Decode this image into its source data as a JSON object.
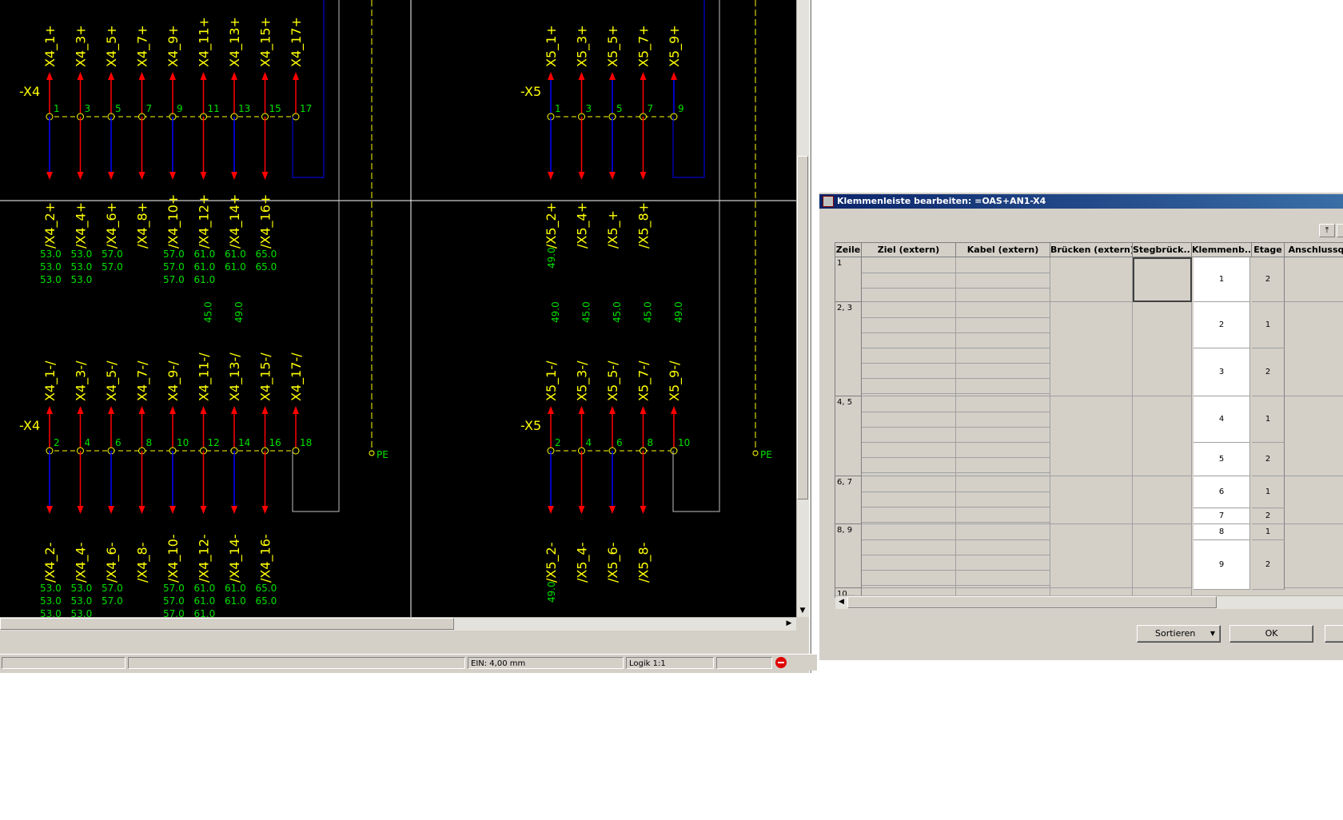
{
  "cad": {
    "colors": {
      "background": "#000000",
      "wire_red": "#ff0000",
      "wire_blue": "#0000ff",
      "wire_gray": "#c0c0c0",
      "text_yellow": "#ffff00",
      "text_green": "#00e000"
    },
    "blocks": {
      "x4_top": {
        "strip": "-X4",
        "terminals": [
          "1",
          "3",
          "5",
          "7",
          "9",
          "11",
          "13",
          "15",
          "17"
        ],
        "top_labels": [
          "X4_1+",
          "X4_3+",
          "X4_5+",
          "X4_7+",
          "X4_9+",
          "X4_11+",
          "X4_13+",
          "X4_15+",
          "X4_17+"
        ],
        "bottom_labels": [
          "/X4_2+",
          "/X4_4+",
          "/X4_6+",
          "/X4_8+",
          "/X4_10+",
          "/X4_12+",
          "/X4_14+",
          "/X4_16+"
        ],
        "xrefs": [
          [
            "53.0",
            "53.0",
            "53.0"
          ],
          [
            "53.0",
            "53.0",
            "53.0"
          ],
          [
            "57.0",
            "57.0"
          ],
          [],
          [
            "57.0",
            "57.0",
            "57.0"
          ],
          [
            "61.0",
            "61.0",
            "61.0"
          ],
          [
            "61.0",
            "61.0"
          ],
          [
            "65.0",
            "65.0"
          ]
        ]
      },
      "x5_top": {
        "strip": "-X5",
        "terminals": [
          "1",
          "3",
          "5",
          "7",
          "9"
        ],
        "top_labels": [
          "X5_1+",
          "X5_3+",
          "X5_5+",
          "X5_7+",
          "X5_9+"
        ],
        "bottom_labels": [
          "/X5_2+",
          "/X5_4+",
          "/X5_+",
          "/X5_8+"
        ],
        "side_xref": "49.0"
      },
      "x4_bottom": {
        "strip": "-X4",
        "terminals": [
          "2",
          "4",
          "6",
          "8",
          "10",
          "12",
          "14",
          "16",
          "18"
        ],
        "top_labels": [
          "X4_1-/",
          "X4_3-/",
          "X4_5-/",
          "X4_7-/",
          "X4_9-/",
          "X4_11-/",
          "X4_13-/",
          "X4_15-/",
          "X4_17-/"
        ],
        "top_xrefs": [
          "",
          "",
          "",
          "",
          "",
          "45.0",
          "49.0",
          "",
          ""
        ],
        "bottom_labels": [
          "/X4_2-",
          "/X4_4-",
          "/X4_6-",
          "/X4_8-",
          "/X4_10-",
          "/X4_12-",
          "/X4_14-",
          "/X4_16-"
        ],
        "xrefs": [
          [
            "53.0",
            "53.0",
            "53.0"
          ],
          [
            "53.0",
            "53.0",
            "53.0"
          ],
          [
            "57.0",
            "57.0"
          ],
          [],
          [
            "57.0",
            "57.0",
            "57.0"
          ],
          [
            "61.0",
            "61.0",
            "61.0"
          ],
          [
            "61.0",
            "61.0"
          ],
          [
            "65.0",
            "65.0"
          ]
        ]
      },
      "x5_bottom": {
        "strip": "-X5",
        "terminals": [
          "2",
          "4",
          "6",
          "8",
          "10"
        ],
        "top_labels": [
          "X5_1-/",
          "X5_3-/",
          "X5_5-/",
          "X5_7-/",
          "X5_9-/"
        ],
        "top_xrefs": [
          "49.0",
          "45.0",
          "45.0",
          "45.0",
          "49.0"
        ],
        "bottom_labels": [
          "/X5_2-",
          "/X5_4-",
          "/X5_6-",
          "/X5_8-"
        ],
        "side_xref": "49.0"
      }
    },
    "pe_label": "PE"
  },
  "statusbar": {
    "cell1": "",
    "cell2": "",
    "ein": "EIN: 4,00 mm",
    "logik": "Logik 1:1",
    "cell5": ""
  },
  "dialog": {
    "title": "Klemmenleiste bearbeiten: =OAS+AN1-X4",
    "toolbar_icon": "sort-up-icon",
    "columns": [
      "Zeile",
      "Ziel (extern)",
      "Kabel (extern)",
      "Brücken (extern)",
      "Stegbrück...",
      "Klemmenb...",
      "Etage",
      "Anschlussq"
    ],
    "rows": [
      {
        "zeile": "1"
      },
      {
        "zeile": "2, 3"
      },
      {
        "zeile": "4, 5"
      },
      {
        "zeile": "6, 7"
      },
      {
        "zeile": "8, 9"
      },
      {
        "zeile": "10..."
      }
    ],
    "terminals": [
      {
        "nr": "1",
        "etage": "2"
      },
      {
        "nr": "2",
        "etage": "1"
      },
      {
        "nr": "3",
        "etage": "2"
      },
      {
        "nr": "4",
        "etage": "1"
      },
      {
        "nr": "5",
        "etage": "2"
      },
      {
        "nr": "6",
        "etage": "1"
      },
      {
        "nr": "7",
        "etage": "2"
      },
      {
        "nr": "8",
        "etage": "1"
      },
      {
        "nr": "9",
        "etage": "2"
      }
    ],
    "buttons": {
      "sort": "Sortieren",
      "ok": "OK"
    }
  }
}
